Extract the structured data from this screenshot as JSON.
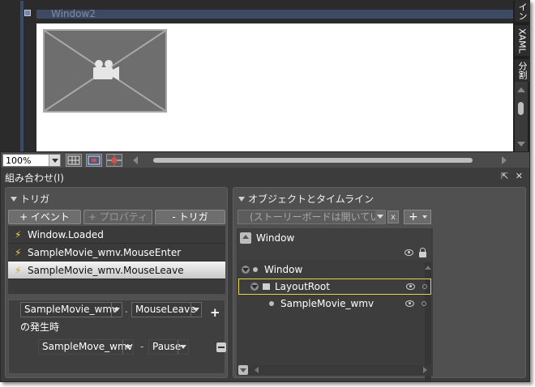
{
  "designer": {
    "window_title": "Window2"
  },
  "side_tabs": {
    "tab_top": "イン",
    "xaml": "XAML",
    "split": "分割"
  },
  "zoom": {
    "value": "100%"
  },
  "panel": {
    "title": "組み合わせ(I)"
  },
  "triggers": {
    "section_title": "トリガ",
    "add_event_label": "+ イベント",
    "add_property_label": "+ プロパティ",
    "remove_trigger_label": "- トリガ",
    "items": [
      {
        "label": "Window.Loaded"
      },
      {
        "label": "SampleMovie_wmv.MouseEnter"
      },
      {
        "label": "SampleMovie_wmv.MouseLeave"
      }
    ],
    "condition": {
      "source": "SampleMovie_wmv",
      "separator": ".",
      "event": "MouseLeave",
      "when_label": "の発生時"
    },
    "action": {
      "target": "SampleMove_wmv",
      "separator": "-",
      "method": "Pause"
    }
  },
  "objects": {
    "section_title": "オブジェクトとタイムライン",
    "storyboard_placeholder": "(ストーリーボードは開いてい",
    "close_label": "x",
    "add_label": "+",
    "scope_label": "Window",
    "tree": [
      {
        "label": "Window",
        "level": 0
      },
      {
        "label": "LayoutRoot",
        "level": 1
      },
      {
        "label": "SampleMovie_wmv",
        "level": 2
      }
    ]
  }
}
